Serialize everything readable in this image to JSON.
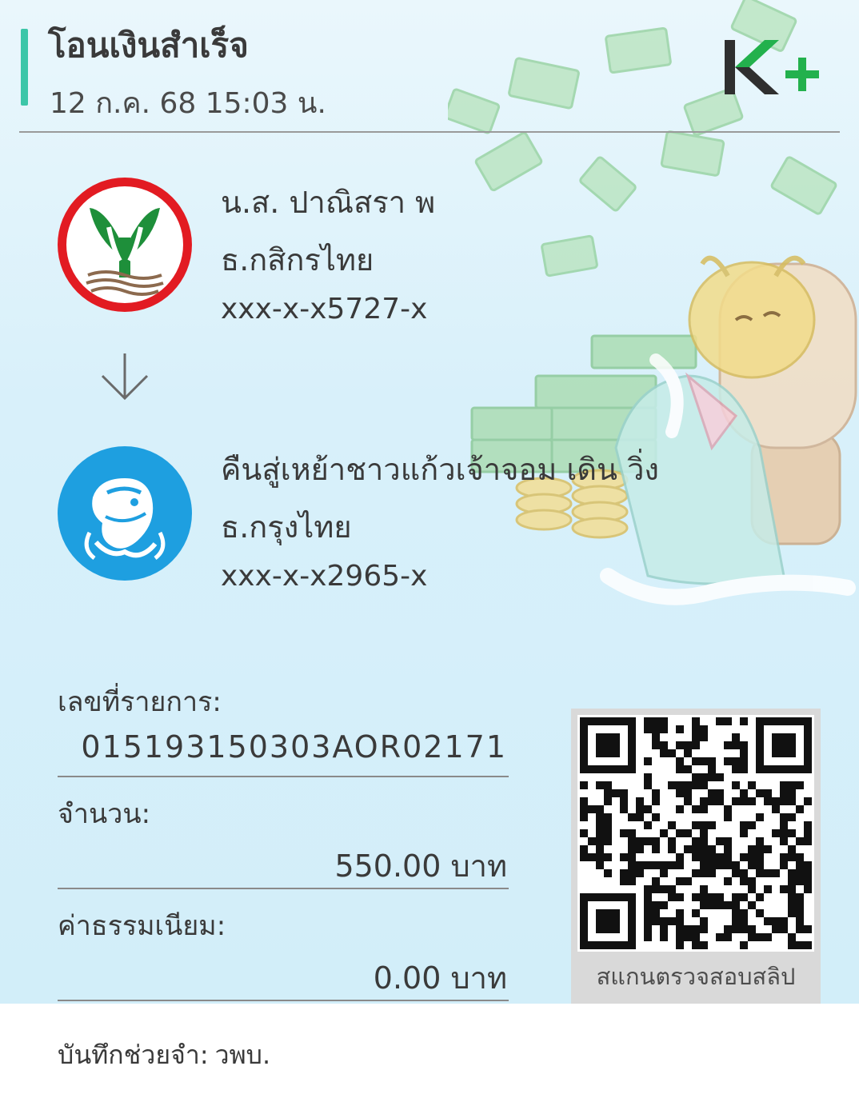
{
  "header": {
    "title": "โอนเงินสำเร็จ",
    "datetime": "12 ก.ค. 68  15:03 น.",
    "logo": "K+"
  },
  "sender": {
    "name": "น.ส. ปาณิสรา พ",
    "bank": "ธ.กสิกรไทย",
    "account": "xxx-x-x5727-x",
    "icon": "kasikorn-bank-logo"
  },
  "direction_icon": "arrow-down-icon",
  "recipient": {
    "name": "คืนสู่เหย้าชาวแก้วเจ้าจอม เดิน วิ่ง",
    "bank": "ธ.กรุงไทย",
    "account": "xxx-x-x2965-x",
    "icon": "krungthai-bank-logo"
  },
  "details": {
    "reference_label": "เลขที่รายการ:",
    "reference_value": "015193150303AOR02171",
    "amount_label": "จำนวน:",
    "amount_value": "550.00 บาท",
    "fee_label": "ค่าธรรมเนียม:",
    "fee_value": "0.00 บาท"
  },
  "qr": {
    "caption": "สแกนตรวจสอบสลิป"
  },
  "memo": {
    "label": "บันทึกช่วยจำ:",
    "value": "วพบ."
  },
  "colors": {
    "accent": "#3cc6a8",
    "kplus_green": "#23b14d",
    "kbank_red": "#e21b22",
    "ktb_blue": "#1e9fe0"
  }
}
